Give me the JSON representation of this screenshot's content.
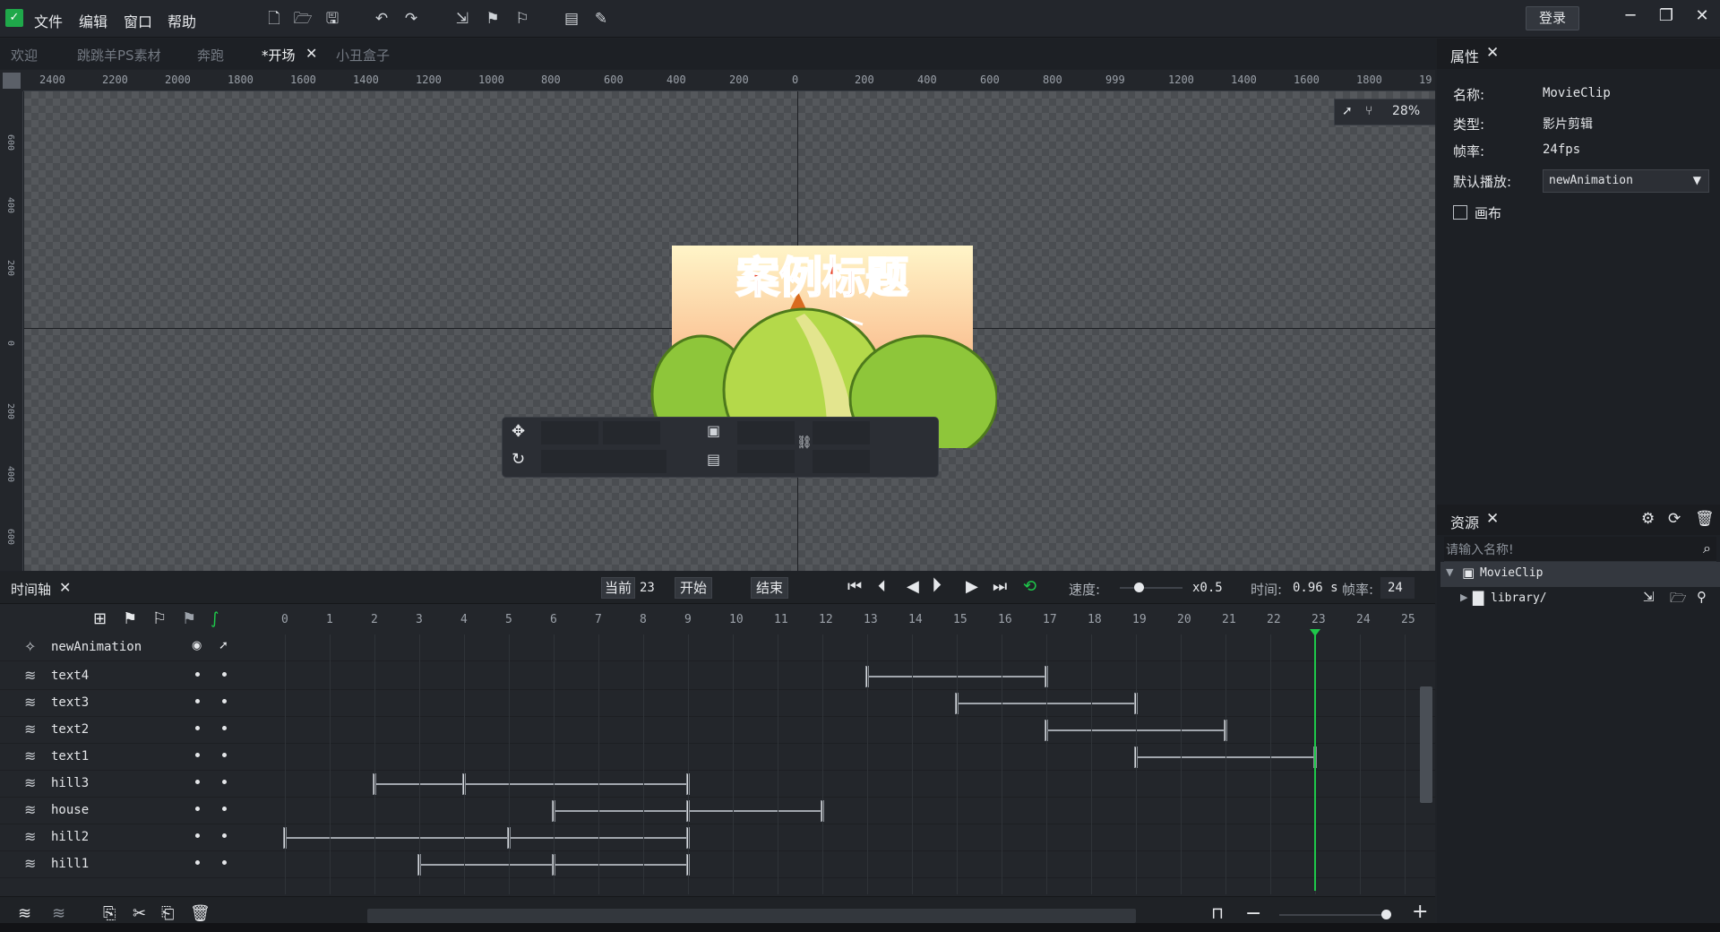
{
  "menu": [
    "文件",
    "编辑",
    "窗口",
    "帮助"
  ],
  "login_label": "登录",
  "tabs": [
    "欢迎",
    "跳跳羊PS素材",
    "奔跑",
    "*开场",
    "小丑盒子"
  ],
  "ruler_top": [
    "2400",
    "2200",
    "2000",
    "1800",
    "1600",
    "1400",
    "1200",
    "1000",
    "800",
    "600",
    "400",
    "200",
    "0",
    "200",
    "400",
    "600",
    "800",
    "999",
    "1200",
    "1400",
    "1600",
    "1800",
    "19"
  ],
  "ruler_left": [
    "600",
    "400",
    "200",
    "0",
    "200",
    "400",
    "600"
  ],
  "zoom": "28%",
  "artwork_title": "案例标题",
  "properties": {
    "title": "属性",
    "name_label": "名称:",
    "name_value": "MovieClip",
    "type_label": "类型:",
    "type_value": "影片剪辑",
    "fps_label": "帧率:",
    "fps_value": "24fps",
    "default_play_label": "默认播放:",
    "default_play_value": "newAnimation",
    "canvas_label": "画布"
  },
  "resources": {
    "title": "资源",
    "search_placeholder": "请输入名称!",
    "tree": [
      "MovieClip",
      "library/"
    ]
  },
  "timeline": {
    "title": "时间轴",
    "current_label": "当前",
    "current_value": "23",
    "start_label": "开始",
    "end_label": "结束",
    "speed_label": "速度:",
    "speed_value": "x0.5",
    "time_label": "时间:",
    "time_value": "0.96 s",
    "fps_label": "帧率:",
    "fps_value": "24",
    "frames": [
      "0",
      "1",
      "2",
      "3",
      "4",
      "5",
      "6",
      "7",
      "8",
      "9",
      "10",
      "11",
      "12",
      "13",
      "14",
      "15",
      "16",
      "17",
      "18",
      "19",
      "20",
      "21",
      "22",
      "23",
      "24",
      "25"
    ],
    "animation_name": "newAnimation",
    "layers": [
      {
        "name": "text4",
        "keys": [
          13,
          17
        ]
      },
      {
        "name": "text3",
        "keys": [
          15,
          19
        ]
      },
      {
        "name": "text2",
        "keys": [
          17,
          21
        ]
      },
      {
        "name": "text1",
        "keys": [
          19,
          23
        ]
      },
      {
        "name": "hill3",
        "keys": [
          2,
          4,
          9
        ]
      },
      {
        "name": "house",
        "keys": [
          6,
          9,
          12
        ]
      },
      {
        "name": "hill2",
        "keys": [
          0,
          5,
          9
        ]
      },
      {
        "name": "hill1",
        "keys": [
          3,
          6,
          9
        ]
      }
    ],
    "playhead": 23
  }
}
